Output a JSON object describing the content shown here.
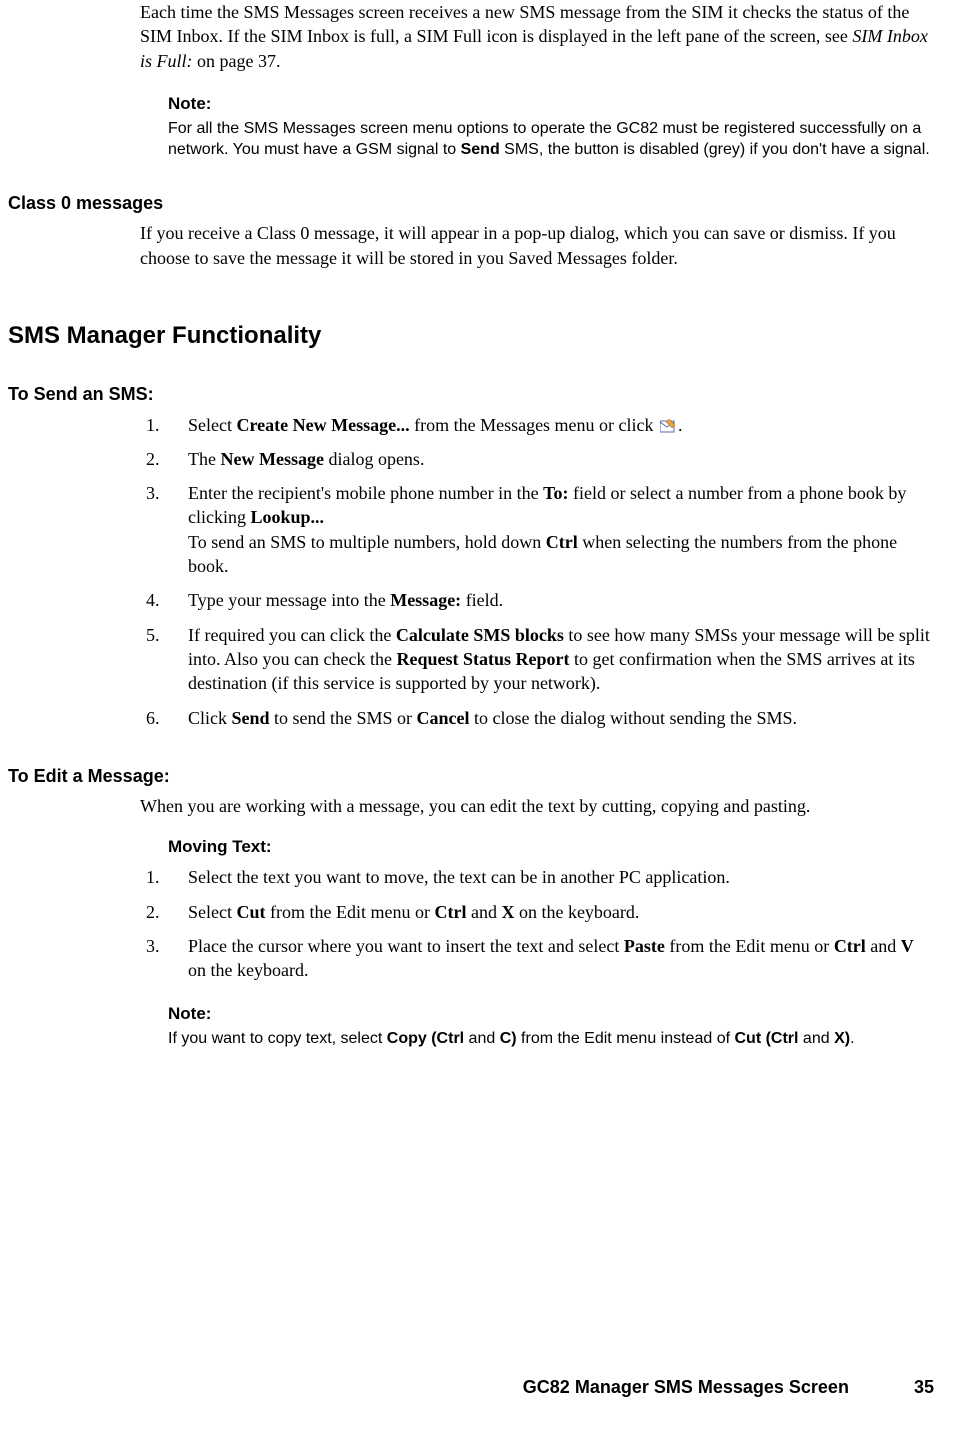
{
  "intro": {
    "p1a": "Each time the SMS Messages screen receives a new SMS message from the SIM it checks the status of the SIM Inbox. If the SIM Inbox is full, a SIM Full icon is displayed in the left pane of the screen, see ",
    "p1_italic": "SIM Inbox is Full:",
    "p1b": " on page 37."
  },
  "note1": {
    "label": "Note:",
    "a": "For all the SMS Messages screen menu options to operate the GC82 must be registered successfully on a network. You must have a GSM signal to ",
    "b": "Send",
    "c": " SMS, the button is disabled (grey) if you don't have a signal."
  },
  "class0": {
    "heading": "Class 0 messages",
    "body": "If you receive a Class 0 message, it will appear in a pop-up dialog, which you can save or dismiss. If you choose to save the message it will be stored in you Saved Messages folder."
  },
  "sms_mgr_heading": "SMS Manager Functionality",
  "send_sms": {
    "heading": "To Send an SMS:",
    "items": [
      {
        "n": "1.",
        "a": "Select ",
        "b": "Create New Message...",
        "c": " from the Messages menu or click ",
        "d": "."
      },
      {
        "n": "2.",
        "a": "The ",
        "b": "New Message",
        "c": " dialog opens."
      },
      {
        "n": "3.",
        "a": "Enter the recipient's mobile phone number in the ",
        "b": "To:",
        "c": " field or select a number from a phone book by clicking ",
        "d": "Lookup...",
        "e": "To send an SMS to multiple numbers, hold down ",
        "f": "Ctrl",
        "g": " when selecting the numbers from the phone book."
      },
      {
        "n": "4.",
        "a": "Type your message into the ",
        "b": "Message:",
        "c": " field."
      },
      {
        "n": "5.",
        "a": "If required you can click the ",
        "b": "Calculate SMS blocks",
        "c": " to see how many SMSs your message will be split into. Also you can check the ",
        "d": "Request Status Report",
        "e": " to get confirmation when the SMS arrives at its destination (if this service is supported by your network)."
      },
      {
        "n": "6.",
        "a": "Click ",
        "b": "Send",
        "c": " to send the SMS or ",
        "d": "Cancel",
        "e": " to close the dialog without sending the SMS."
      }
    ]
  },
  "edit_msg": {
    "heading": "To Edit a Message:",
    "intro": "When you are working with a message, you can edit the text by cutting, copying and pasting.",
    "moving_heading": "Moving Text:",
    "items": [
      {
        "n": "1.",
        "a": "Select the text you want to move, the text can be in another PC application."
      },
      {
        "n": "2.",
        "a": "Select ",
        "b": "Cut",
        "c": " from the Edit menu or ",
        "d": "Ctrl",
        "e": " and ",
        "f": "X",
        "g": " on the keyboard."
      },
      {
        "n": "3.",
        "a": "Place the cursor where you want to insert the text and select ",
        "b": "Paste",
        "c": " from the Edit menu or ",
        "d": "Ctrl",
        "e": " and ",
        "f": "V",
        "g": " on the keyboard."
      }
    ]
  },
  "note2": {
    "label": "Note:",
    "a": "If you want to copy text, select ",
    "b": "Copy (Ctrl",
    "c": " and ",
    "d": "C)",
    "e": " from the Edit menu instead of ",
    "f": "Cut (Ctrl",
    "g": " and ",
    "h": "X)",
    "i": "."
  },
  "footer": {
    "title": "GC82 Manager SMS Messages Screen",
    "page": "35"
  }
}
